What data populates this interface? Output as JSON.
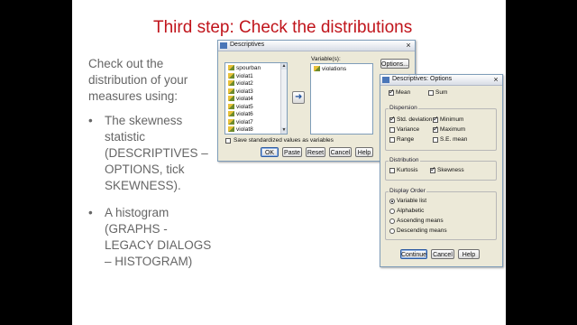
{
  "slide": {
    "title": "Third step: Check the distributions",
    "intro": "Check out the distribution of your measures using:",
    "bullets": [
      {
        "marker": "•",
        "text": "The skewness statistic (DESCRIPTIVES – OPTIONS, tick SKEWNESS)."
      },
      {
        "marker": "•",
        "text": "A histogram (GRAPHS - LEGACY DIALOGS – HISTOGRAM)"
      }
    ]
  },
  "descriptives": {
    "title": "Descriptives",
    "close": "×",
    "source_list": [
      "spourban",
      "violat1",
      "violat2",
      "violat3",
      "violat4",
      "violat5",
      "violat6",
      "violat7",
      "violat8"
    ],
    "variables_label": "Variable(s):",
    "variables": [
      "violations"
    ],
    "options_button": "Options...",
    "move_arrow": "➜",
    "save_label": "Save standardized values as variables",
    "save_checked": false,
    "buttons": {
      "ok": "OK",
      "paste": "Paste",
      "reset": "Reset",
      "cancel": "Cancel",
      "help": "Help"
    },
    "scroll_up": "▲",
    "scroll_down": "▼"
  },
  "options": {
    "title": "Descriptives: Options",
    "close": "×",
    "mean": {
      "label": "Mean",
      "checked": true
    },
    "sum": {
      "label": "Sum",
      "checked": false
    },
    "dispersion": {
      "title": "Dispersion",
      "std_dev": {
        "label": "Std. deviation",
        "checked": true
      },
      "minimum": {
        "label": "Minimum",
        "checked": true
      },
      "variance": {
        "label": "Variance",
        "checked": false
      },
      "maximum": {
        "label": "Maximum",
        "checked": true
      },
      "range": {
        "label": "Range",
        "checked": false
      },
      "se_mean": {
        "label": "S.E. mean",
        "checked": false
      }
    },
    "distribution": {
      "title": "Distribution",
      "kurtosis": {
        "label": "Kurtosis",
        "checked": false
      },
      "skewness": {
        "label": "Skewness",
        "checked": true
      }
    },
    "display_order": {
      "title": "Display Order",
      "options": [
        "Variable list",
        "Alphabetic",
        "Ascending means",
        "Descending means"
      ],
      "selected": "Variable list"
    },
    "buttons": {
      "continue": "Continue",
      "cancel": "Cancel",
      "help": "Help"
    }
  }
}
